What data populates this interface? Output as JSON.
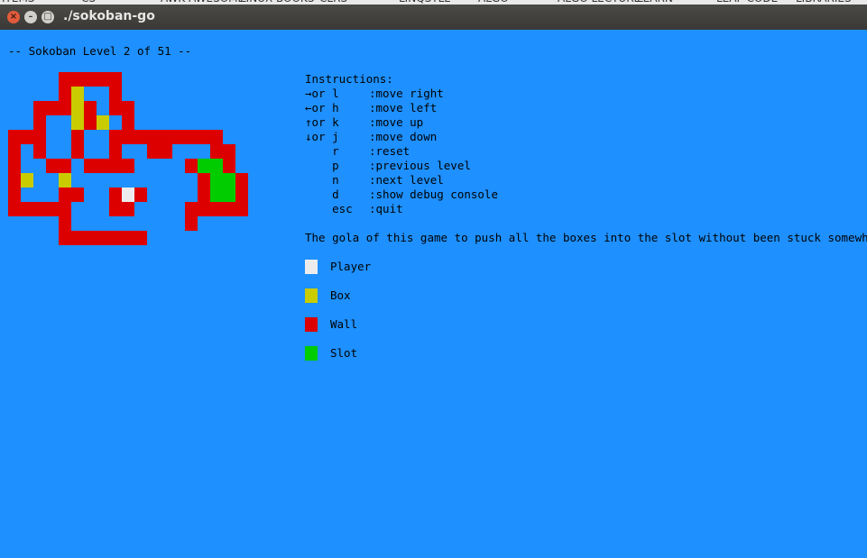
{
  "window": {
    "title": "./sokoban-go"
  },
  "bookmarks": [
    "ITEMS",
    "CS",
    "AWK AWESOME",
    "LINUX BOOKS",
    "CLRS",
    "LINQSTLL",
    "ALGO",
    "ALGO LECTURE",
    "LEARN",
    "LEAP CODE",
    "LIBRARIES"
  ],
  "header": {
    "level_text": "-- Sokoban Level 2 of 51 --"
  },
  "instructions": {
    "title": "Instructions:",
    "rows": [
      {
        "key": "→or l",
        "desc": ":move right"
      },
      {
        "key": "←or h",
        "desc": ":move left"
      },
      {
        "key": "↑or k",
        "desc": ":move up"
      },
      {
        "key": "↓or j",
        "desc": ":move down"
      },
      {
        "key": "    r",
        "desc": ":reset"
      },
      {
        "key": "    p",
        "desc": ":previous level"
      },
      {
        "key": "    n",
        "desc": ":next level"
      },
      {
        "key": "    d",
        "desc": ":show debug console"
      },
      {
        "key": "    esc",
        "desc": ":quit"
      }
    ]
  },
  "goal_text": "The gola of this game to push all the boxes into the slot without been stuck somewhere.",
  "legend": [
    {
      "label": "Player",
      "color": "#ececec"
    },
    {
      "label": "Box",
      "color": "#c9cc00"
    },
    {
      "label": "Wall",
      "color": "#dd0000"
    },
    {
      "label": "Slot",
      "color": "#00cc00"
    }
  ],
  "colors": {
    "background": "#1e90ff",
    "wall": "#dd0000",
    "box": "#c9cc00",
    "slot": "#00cc00",
    "player": "#ececec"
  },
  "board": {
    "legend": {
      "#": "wall",
      "B": "box",
      "S": "slot",
      "P": "player",
      " ": "floor"
    },
    "rows": [
      "    #####         ",
      "    #B  #         ",
      "  ###B# ##        ",
      "  #  B#B #        ",
      "###  #  #########",
      "# #  #  #  ##   ##",
      "#  ## ####    #SS#",
      "#B  B          #SS#",
      "#   ##  #P#    #SS#",
      "#####   ##    ##### ",
      "    #         #     ",
      "    #######         "
    ]
  }
}
